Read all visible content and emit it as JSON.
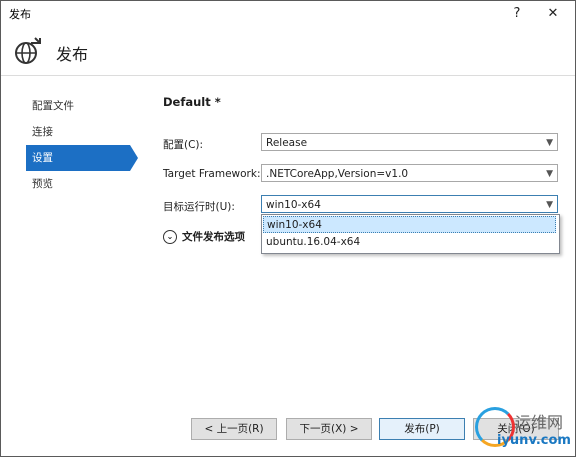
{
  "window": {
    "title": "发布",
    "help": "?",
    "close": "✕"
  },
  "header": {
    "title": "发布"
  },
  "sidebar": {
    "items": [
      {
        "label": "配置文件",
        "active": false
      },
      {
        "label": "连接",
        "active": false
      },
      {
        "label": "设置",
        "active": true
      },
      {
        "label": "预览",
        "active": false
      }
    ]
  },
  "main": {
    "profile_name": "Default *",
    "configuration": {
      "label": "配置(C):",
      "value": "Release"
    },
    "framework": {
      "label": "Target Framework:",
      "value": ".NETCoreApp,Version=v1.0"
    },
    "runtime": {
      "label": "目标运行时(U):",
      "value": "win10-x64",
      "options": [
        "win10-x64",
        "ubuntu.16.04-x64"
      ]
    },
    "file_publish_options": "文件发布选项"
  },
  "footer": {
    "prev": "< 上一页(R)",
    "next": "下一页(X) >",
    "publish": "发布(P)",
    "close": "关闭(O)"
  },
  "watermark": {
    "text1": "运维网",
    "text2": "iyunv.com"
  },
  "colors": {
    "accent": "#1c6fc4",
    "selection": "#cce8ff"
  }
}
